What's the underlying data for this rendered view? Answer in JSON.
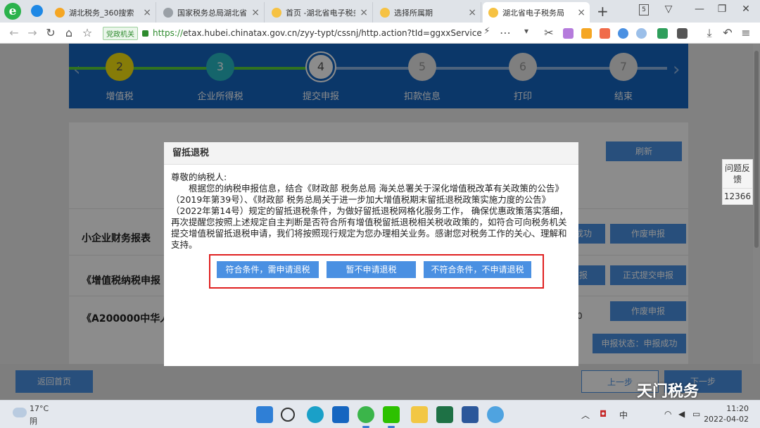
{
  "browser": {
    "logo_letter": "e",
    "tabs": [
      {
        "label": "湖北税务_360搜索",
        "fav_color": "#f5a623"
      },
      {
        "label": "国家税务总局湖北省税",
        "fav_color": "#9aa0a6"
      },
      {
        "label": "首页 -湖北省电子税务",
        "fav_color": "#f6c243"
      },
      {
        "label": "选择所属期",
        "fav_color": "#f6c243"
      },
      {
        "label": "湖北省电子税务局",
        "fav_color": "#f6c243"
      }
    ],
    "close_glyph": "×",
    "new_tab_glyph": "+",
    "address": {
      "badge": "党政机关",
      "scheme": "https://",
      "url_rest": "etax.hubei.chinatax.gov.cn/zyy-typt/cssnj/http.action?tId=ggxxService"
    }
  },
  "steps": [
    {
      "num": "2",
      "label": "增值税",
      "state": "done"
    },
    {
      "num": "3",
      "label": "企业所得税",
      "state": "done2"
    },
    {
      "num": "4",
      "label": "提交申报",
      "state": "current"
    },
    {
      "num": "5",
      "label": "扣款信息",
      "state": "todo"
    },
    {
      "num": "6",
      "label": "打印",
      "state": "todo"
    },
    {
      "num": "7",
      "label": "结束",
      "state": "todo"
    }
  ],
  "content": {
    "refresh_label": "刷新",
    "rows": [
      {
        "title": "小企业财务报表",
        "btn_left": "成功",
        "btn_right": "作废申报"
      },
      {
        "title": "《增值税纳税申报",
        "btn_left": "报",
        "btn_right": "正式提交申报"
      },
      {
        "title": "《A200000中华人",
        "btn_left": "0",
        "btn_right": "作废申报"
      }
    ],
    "status_label": "申报状态：申报成功"
  },
  "bottom": {
    "back_home": "返回首页",
    "prev": "上一步",
    "next": "下一步"
  },
  "dialog": {
    "title": "留抵退税",
    "greeting": "尊敬的纳税人:",
    "body": "根据您的纳税申报信息，结合《财政部 税务总局 海关总署关于深化增值税改革有关政策的公告》（2019年第39号）、《财政部 税务总局关于进一步加大增值税期末留抵退税政策实施力度的公告》（2022年第14号）规定的留抵退税条件，为做好留抵退税网格化服务工作， 确保优惠政策落实落细，再次提醒您按照上述规定自主判断是否符合所有增值税留抵退税相关税收政策的，如符合可向税务机关提交增值税留抵退税申请，我们将按照现行规定为您办理相关业务。感谢您对税务工作的关心、理解和支持。",
    "buttons": [
      "符合条件，需申请退税",
      "暂不申请退税",
      "不符合条件，不申请退税"
    ]
  },
  "side": {
    "feedback": "问题反馈",
    "hotline": "12366"
  },
  "watermark": "天门税务",
  "taskbar": {
    "temp": "17°C",
    "weather": "阴",
    "ime": "中",
    "time": "11:20",
    "date": "2022-04-02"
  },
  "colors": {
    "stepper_bg": "#1565c0",
    "primary_button": "#4a90e2",
    "highlight_border": "#e02020",
    "progress_done": "#5ad03a"
  }
}
